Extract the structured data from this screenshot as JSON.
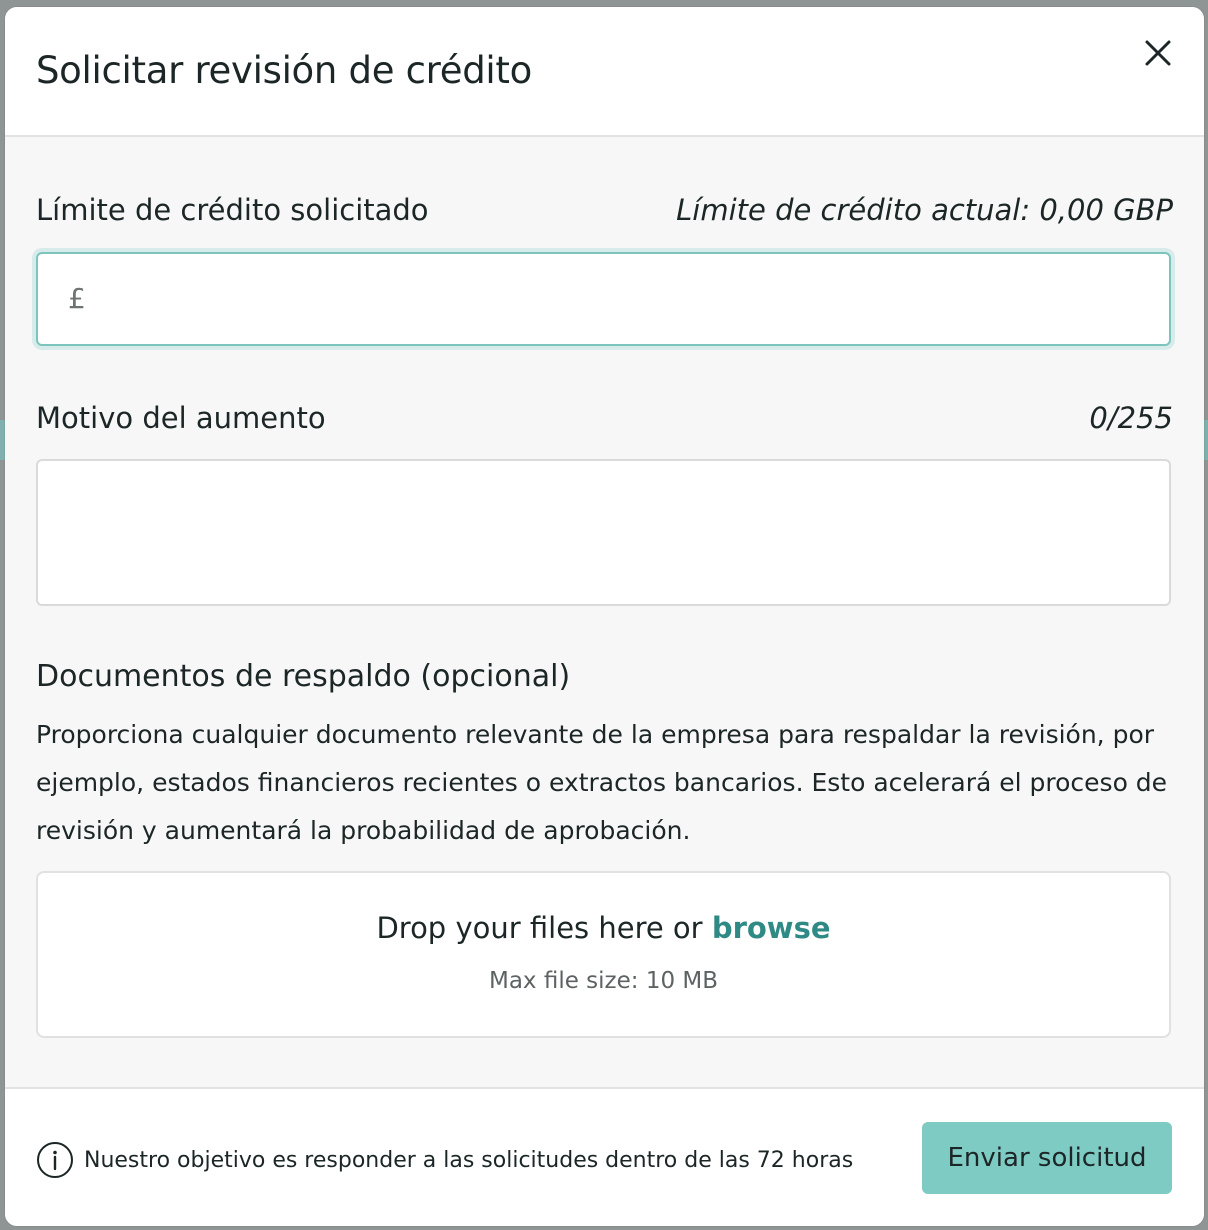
{
  "modal": {
    "title": "Solicitar revisión de crédito",
    "close_icon": "close-icon"
  },
  "credit_limit": {
    "label": "Límite de crédito solicitado",
    "current_limit_text": "Límite de crédito actual: 0,00 GBP",
    "currency_symbol": "£",
    "value": ""
  },
  "reason": {
    "label": "Motivo del aumento",
    "char_counter": "0/255",
    "value": ""
  },
  "documents": {
    "heading": "Documentos de respaldo (opcional)",
    "description": "Proporciona cualquier documento relevante de la empresa para respaldar la revisión, por ejemplo, estados financieros recientes o extractos bancarios. Esto acelerará el proceso de revisión y aumentará la probabilidad de aprobación.",
    "dropzone_text": "Drop your files here or",
    "browse_label": "browse",
    "max_size_text": "Max file size: 10 MB"
  },
  "footer": {
    "info_icon": "info-icon",
    "note": "Nuestro objetivo es responder a las solicitudes dentro de las 72 horas",
    "submit_label": "Enviar solicitud"
  },
  "colors": {
    "accent": "#7ecbc4",
    "link": "#2f8a85",
    "input_focus_border": "#7cc5bd"
  }
}
